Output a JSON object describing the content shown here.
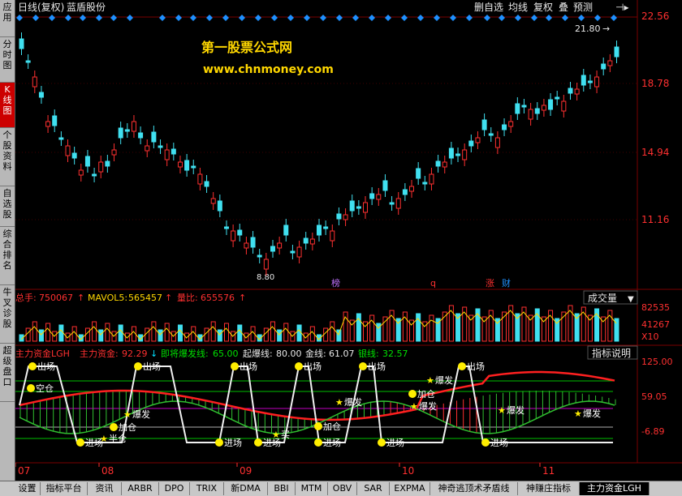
{
  "title": {
    "chart_type": "日线(复权)",
    "stock_name": "蓝盾股份"
  },
  "toolbar": [
    "删自选",
    "均线",
    "复权",
    "叠",
    "预测"
  ],
  "watermark": {
    "line1": "第一股票公式网",
    "line2": "www.chnmoney.com"
  },
  "left_tabs": [
    "应用",
    "分时图",
    "K线图",
    "个股资料",
    "自选股",
    "综合排名",
    "牛叉诊股",
    "超级盘口"
  ],
  "price_axis": [
    "22.56",
    "18.78",
    "14.94",
    "11.16"
  ],
  "price_high_label": "21.80",
  "price_low_label": "8.80",
  "markers": {
    "bang": "榜",
    "q": "q",
    "zhang": "涨",
    "cai": "财"
  },
  "volume_panel": {
    "label1": "总手:",
    "value1": "750067",
    "label2": "MAVOL5:",
    "value2": "565457",
    "label3": "量比:",
    "value3": "655576",
    "dropdown": "成交量",
    "axis": [
      "82535",
      "41267",
      "X10"
    ]
  },
  "indicator_panel": {
    "name": "主力资金LGH",
    "l1": "主力资金:",
    "v1": "92.29",
    "l2": "即将爆发线:",
    "v2": "65.00",
    "l3": "起爆线:",
    "v3": "80.00",
    "l4": "金线:",
    "v4": "61.07",
    "l5": "银线:",
    "v5": "32.57",
    "help": "指标说明",
    "axis": [
      "125.00",
      "59.05",
      "-6.89"
    ]
  },
  "signals": {
    "out": "出场",
    "in": "进场",
    "empty": "空仓",
    "add": "加仓",
    "boom": "爆发",
    "half": "半仓",
    "buy": "买"
  },
  "date_axis": [
    "07",
    "08",
    "09",
    "10",
    "11"
  ],
  "bottom_tabs": [
    "设置",
    "指标平台",
    "资讯",
    "ARBR",
    "DPO",
    "TRIX",
    "新DMA",
    "BBI",
    "MTM",
    "OBV",
    "SAR",
    "EXPMA",
    "神奇逃顶术矛盾线",
    "神赚庄指标",
    "主力资金LGH"
  ]
}
